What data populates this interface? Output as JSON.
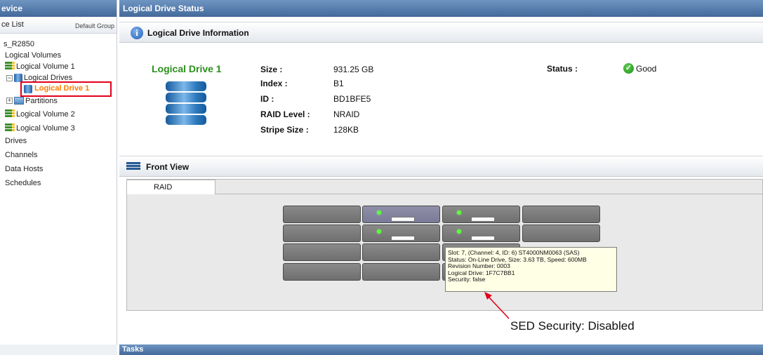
{
  "left": {
    "header": "evice",
    "device_list_title": "ce List",
    "default_group": "Default Group",
    "tree": {
      "device": "s_R2850",
      "logical_volumes": "Logical Volumes",
      "volume1": "Logical Volume 1",
      "logical_drives": "Logical Drives",
      "logical_drive1": "Logical Drive 1",
      "partitions": "Partitions",
      "volume2": "Logical Volume 2",
      "volume3": "Logical Volume 3",
      "drives": "Drives",
      "channels": "Channels",
      "data_hosts": "Data Hosts",
      "schedules": "Schedules"
    }
  },
  "right": {
    "header": "Logical Drive Status",
    "info_section_title": "Logical Drive Information",
    "drive_name": "Logical Drive 1",
    "fields": {
      "size_label": "Size :",
      "size_value": "931.25 GB",
      "index_label": "Index :",
      "index_value": "B1",
      "id_label": "ID :",
      "id_value": "BD1BFE5",
      "raid_label": "RAID Level :",
      "raid_value": "NRAID",
      "stripe_label": "Stripe Size :",
      "stripe_value": "128KB"
    },
    "status_label": "Status :",
    "status_value": "Good",
    "front_view_title": "Front View",
    "front_view_tab": "RAID",
    "tooltip": {
      "line1": "Slot: 7, (Channel: 4, ID: 6) ST4000NM0063    (SAS)",
      "line2": "Status: On-Line Drive, Size: 3.63 TB, Speed: 600MB",
      "line3": "Revision Number: 0003",
      "line4": "Logical Drive: 1F7C7BB1",
      "line5": "Security: false"
    },
    "annotation": "SED Security: Disabled",
    "tasks_header": "Tasks"
  },
  "colors": {
    "header_blue": "#43699a",
    "drive_name_green": "#2b8f1c",
    "selected_orange": "#ff7b00",
    "highlight_red": "#e3001b"
  }
}
